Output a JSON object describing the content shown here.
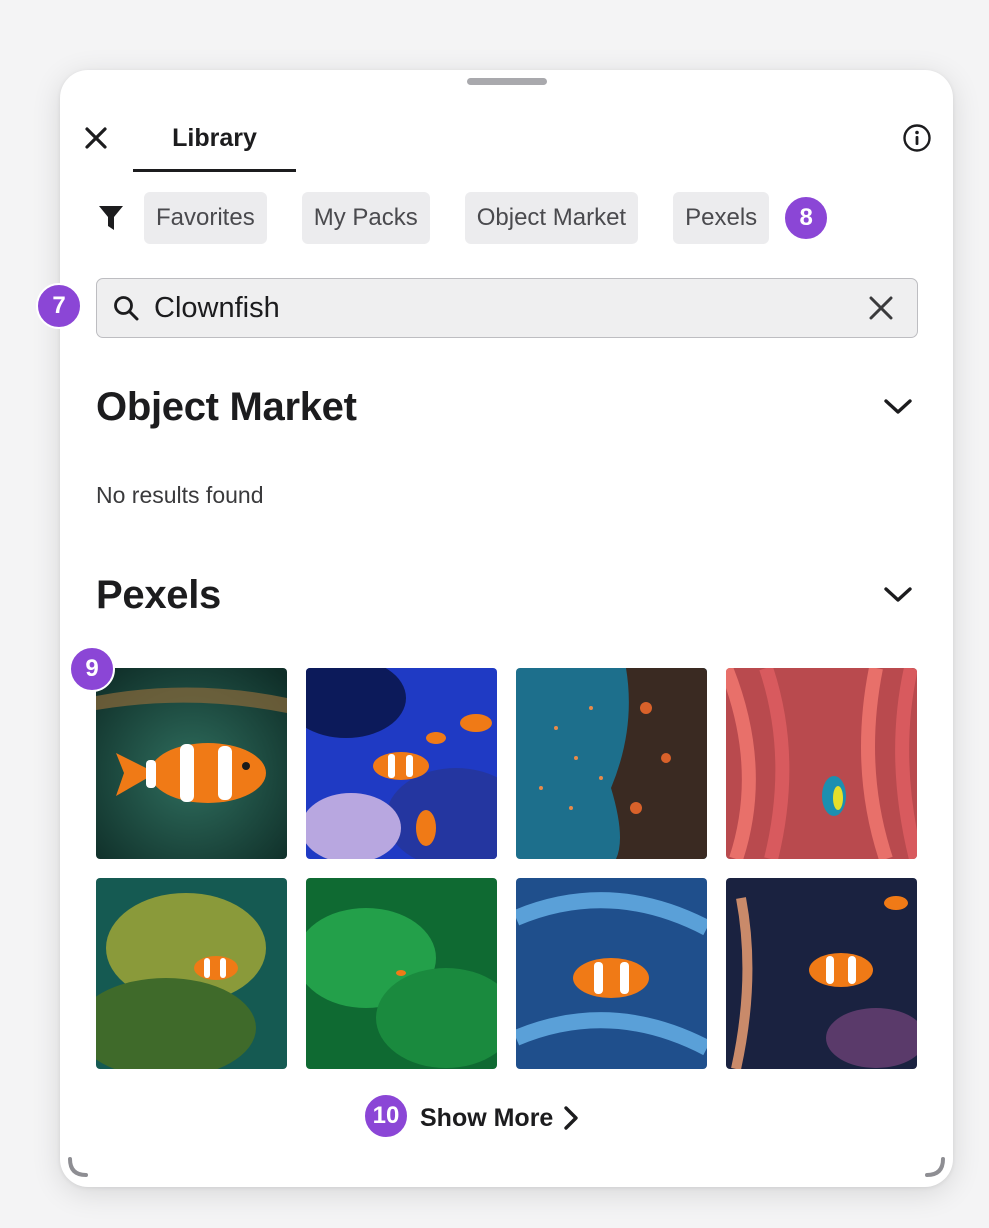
{
  "header": {
    "tab_label": "Library"
  },
  "filters": {
    "chips": [
      "Favorites",
      "My Packs",
      "Object Market",
      "Pexels"
    ]
  },
  "search": {
    "value": "Clownfish"
  },
  "sections": {
    "object_market": {
      "title": "Object Market",
      "empty_message": "No results found"
    },
    "pexels": {
      "title": "Pexels"
    }
  },
  "show_more_label": "Show More",
  "badges": {
    "filter": "8",
    "search": "7",
    "grid": "9",
    "show_more": "10"
  },
  "colors": {
    "badge": "#8b46d6",
    "text": "#1c1c1e",
    "chip_bg": "#ececee"
  },
  "icons": [
    "close-icon",
    "info-icon",
    "filter-icon",
    "search-icon",
    "clear-icon",
    "chevron-down-icon",
    "chevron-right-icon"
  ]
}
